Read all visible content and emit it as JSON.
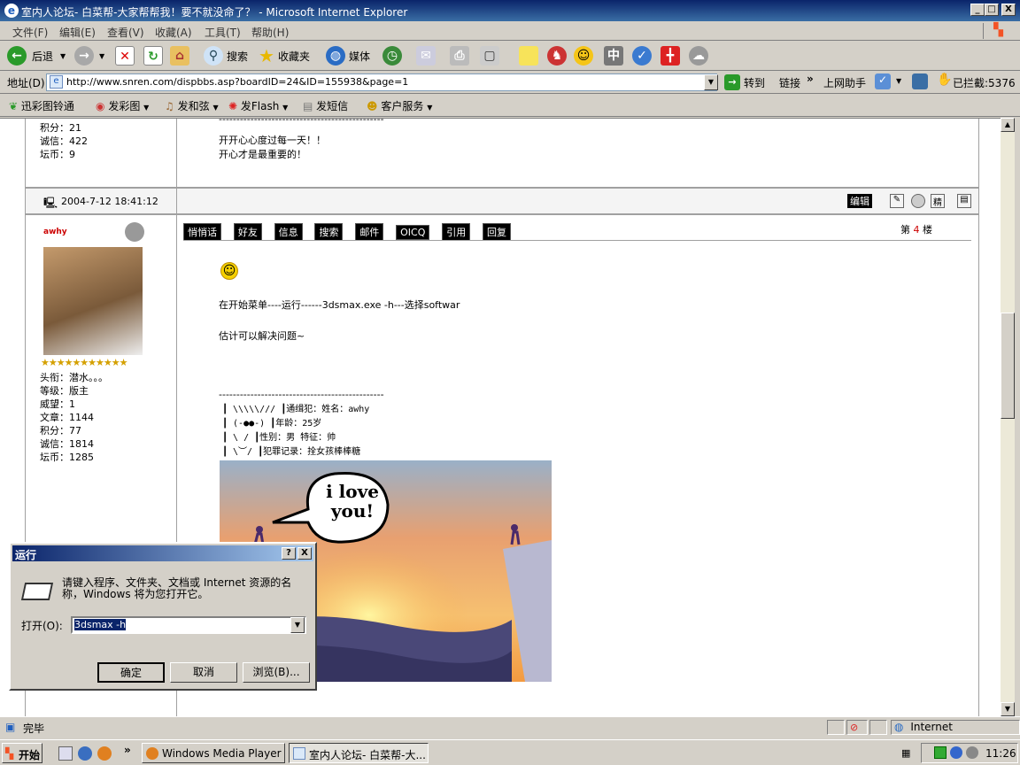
{
  "window": {
    "title": "室内人论坛- 白菜帮-大家帮帮我！要不就没命了？ - Microsoft Internet Explorer",
    "controls": [
      "_",
      "□",
      "X"
    ]
  },
  "menu": [
    "文件(F)",
    "编辑(E)",
    "查看(V)",
    "收藏(A)",
    "工具(T)",
    "帮助(H)"
  ],
  "toolbar": {
    "back": "后退",
    "search": "搜索",
    "favorites": "收藏夹",
    "media": "媒体"
  },
  "address": {
    "label": "地址(D)",
    "url": "http://www.snren.com/dispbbs.asp?boardID=24&ID=155938&page=1",
    "go": "转到",
    "links": "链接",
    "helper": "上网助手",
    "blocked": "已拦截:5376"
  },
  "links_bar": [
    "迅彩图铃通",
    "发彩图",
    "发和弦",
    "发Flash",
    "发短信",
    "客户服务"
  ],
  "prev_post": {
    "stats": [
      "积分：21",
      "诚信：422",
      "坛币：9"
    ],
    "divider": "-----------------------------------------------",
    "lines": [
      "开开心心度过每一天！！",
      "开心才是最重要的！"
    ],
    "date": "2004-7-12 18:41:12",
    "edit_label": "编辑"
  },
  "post": {
    "username": "awhy",
    "buttons": [
      "悄悄话",
      "好友",
      "信息",
      "搜索",
      "邮件",
      "OICQ",
      "引用",
      "回复"
    ],
    "floor_prefix": "第",
    "floor": "4",
    "floor_suffix": "楼",
    "stars": "★★★★★★★★★★★",
    "profile": [
      "头衔：潜水。。。",
      "等级：版主",
      "威望：1",
      "文章：1144",
      "积分：77",
      "诚信：1814",
      "坛币：1285"
    ],
    "body": [
      "在开始菜单----运行------3dsmax.exe -h---选择softwar",
      "估计可以解决问题~"
    ],
    "divider": "-----------------------------------------------",
    "sig": [
      "┃ \\\\\\\\\\/// ┃通缉犯：姓名：awhy",
      "┃ (-●●-) ┃年龄：25岁",
      "┃  \\   /  ┃性别：男 特征：帅",
      "┃   \\︶/   ┃犯罪记录：拴女孩棒棒糖"
    ],
    "image_text": "i love you!"
  },
  "run_dialog": {
    "title": "运行",
    "help": "?",
    "close": "X",
    "message": "请键入程序、文件夹、文档或 Internet 资源的名称，Windows 将为您打开它。",
    "open_label": "打开(O):",
    "value": "3dsmax -h",
    "ok": "确定",
    "cancel": "取消",
    "browse": "浏览(B)..."
  },
  "status": {
    "text": "完毕",
    "zone": "Internet"
  },
  "taskbar": {
    "start": "开始",
    "tasks": [
      "Windows Media Player",
      "室内人论坛- 白菜帮-大..."
    ],
    "clock": "11:26"
  }
}
